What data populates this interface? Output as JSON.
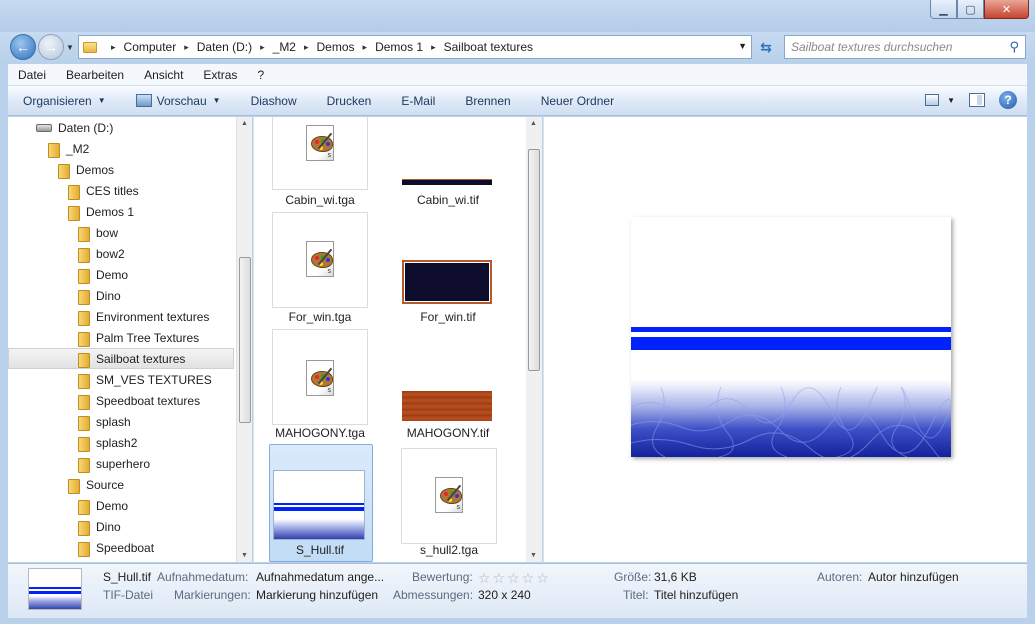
{
  "address": {
    "crumbs": [
      "Computer",
      "Daten (D:)",
      "_M2",
      "Demos",
      "Demos 1",
      "Sailboat textures"
    ]
  },
  "search": {
    "placeholder": "Sailboat textures durchsuchen"
  },
  "menu": [
    "Datei",
    "Bearbeiten",
    "Ansicht",
    "Extras",
    "?"
  ],
  "toolbar": {
    "organize": "Organisieren",
    "preview": "Vorschau",
    "slideshow": "Diashow",
    "print": "Drucken",
    "email": "E-Mail",
    "burn": "Brennen",
    "new_folder": "Neuer Ordner"
  },
  "tree": [
    {
      "label": "Daten (D:)",
      "kind": "drive"
    },
    {
      "label": "_M2",
      "kind": "folder"
    },
    {
      "label": "Demos",
      "kind": "folder"
    },
    {
      "label": "CES titles",
      "kind": "folder"
    },
    {
      "label": "Demos 1",
      "kind": "folder"
    },
    {
      "label": "bow",
      "kind": "folder"
    },
    {
      "label": "bow2",
      "kind": "folder"
    },
    {
      "label": "Demo",
      "kind": "folder"
    },
    {
      "label": "Dino",
      "kind": "folder"
    },
    {
      "label": "Environment textures",
      "kind": "folder"
    },
    {
      "label": "Palm Tree Textures",
      "kind": "folder"
    },
    {
      "label": "Sailboat textures",
      "kind": "folder",
      "selected": true
    },
    {
      "label": "SM_VES TEXTURES",
      "kind": "folder"
    },
    {
      "label": "Speedboat textures",
      "kind": "folder"
    },
    {
      "label": "splash",
      "kind": "folder"
    },
    {
      "label": "splash2",
      "kind": "folder"
    },
    {
      "label": "superhero",
      "kind": "folder"
    },
    {
      "label": "Source",
      "kind": "folder"
    },
    {
      "label": "Demo",
      "kind": "folder"
    },
    {
      "label": "Dino",
      "kind": "folder"
    },
    {
      "label": "Speedboat",
      "kind": "folder"
    }
  ],
  "files": [
    {
      "name": "Cabin_wi.tga",
      "kind": "tga-icon"
    },
    {
      "name": "Cabin_wi.tif",
      "kind": "thumb-cabin"
    },
    {
      "name": "For_win.tga",
      "kind": "tga-icon"
    },
    {
      "name": "For_win.tif",
      "kind": "thumb-forwin"
    },
    {
      "name": "MAHOGONY.tga",
      "kind": "tga-icon"
    },
    {
      "name": "MAHOGONY.tif",
      "kind": "thumb-mahogany"
    },
    {
      "name": "S_Hull.tif",
      "kind": "thumb-hull",
      "selected": true
    },
    {
      "name": "s_hull2.tga",
      "kind": "tga-icon"
    }
  ],
  "details": {
    "filename": "S_Hull.tif",
    "filetype": "TIF-Datei",
    "date_key": "Aufnahmedatum:",
    "date_val": "Aufnahmedatum ange...",
    "tags_key": "Markierungen:",
    "tags_val": "Markierung hinzufügen",
    "rating_key": "Bewertung:",
    "rating_stars": "☆☆☆☆☆",
    "dims_key": "Abmessungen:",
    "dims_val": "320 x 240",
    "size_key": "Größe:",
    "size_val": "31,6 KB",
    "title_key": "Titel:",
    "title_val": "Titel hinzufügen",
    "authors_key": "Autoren:",
    "authors_val": "Autor hinzufügen"
  },
  "colors": {
    "accent_blue": "#0022ff",
    "deep_navy": "#13229c",
    "selection": "#c1dcf6"
  },
  "icons": [
    "back-arrow-icon",
    "forward-arrow-icon",
    "folder-icon",
    "refresh-icon",
    "search-icon",
    "views-icon",
    "preview-pane-icon",
    "help-icon",
    "drive-icon",
    "tga-palette-icon"
  ]
}
